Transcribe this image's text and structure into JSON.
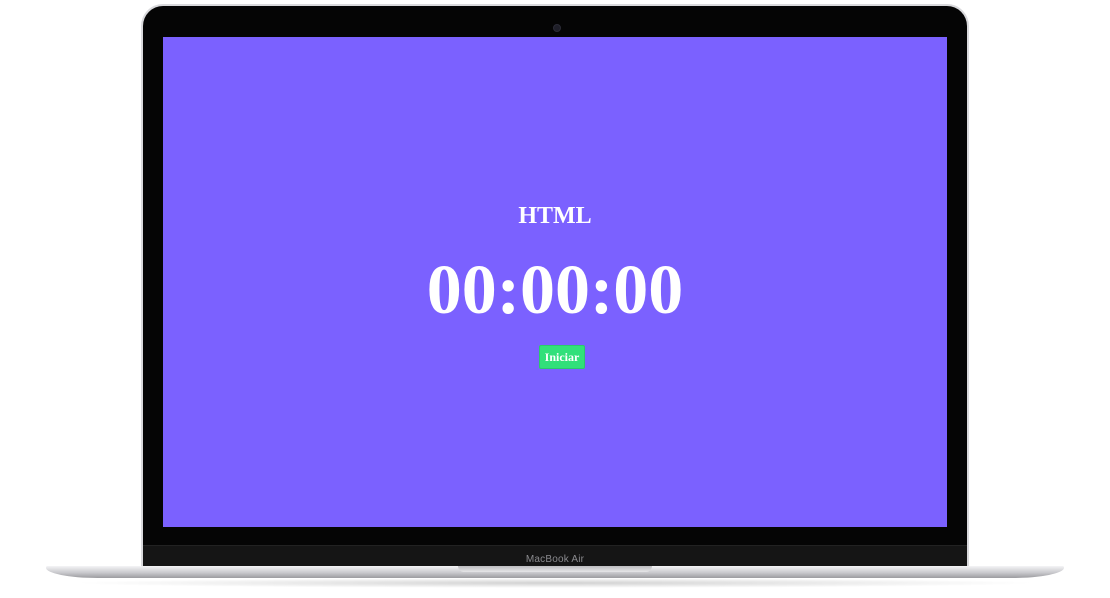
{
  "device": {
    "model_label": "MacBook Air"
  },
  "app": {
    "title": "HTML",
    "timer_display": "00:00:00",
    "start_button_label": "Iniciar"
  },
  "colors": {
    "background": "#7b61ff",
    "text": "#ffffff",
    "start_button": "#31e07a"
  }
}
